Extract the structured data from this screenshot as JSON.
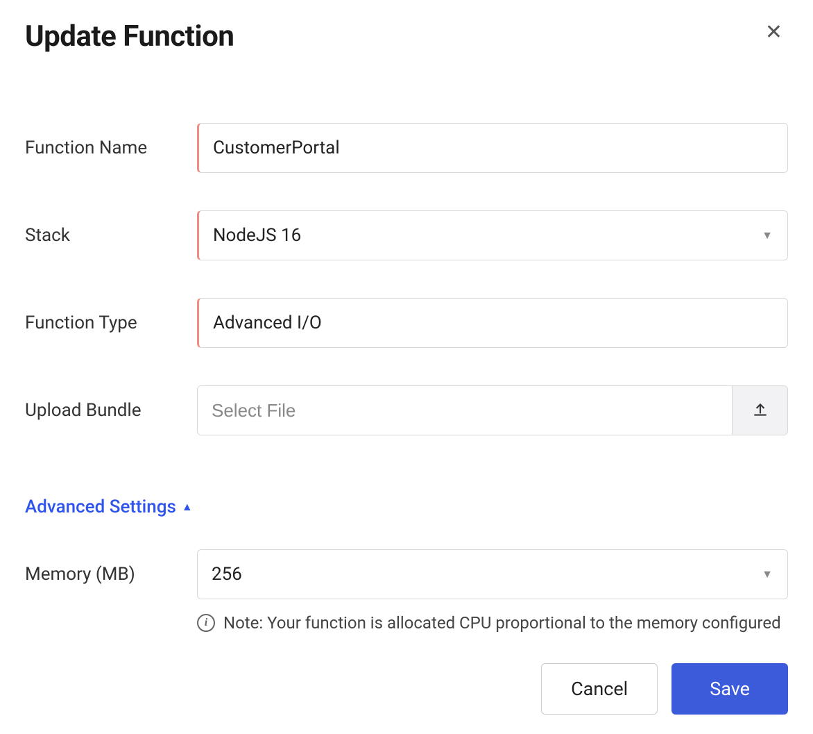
{
  "dialog": {
    "title": "Update Function",
    "fields": {
      "function_name": {
        "label": "Function Name",
        "value": "CustomerPortal"
      },
      "stack": {
        "label": "Stack",
        "value": "NodeJS 16"
      },
      "function_type": {
        "label": "Function Type",
        "value": "Advanced I/O"
      },
      "upload_bundle": {
        "label": "Upload Bundle",
        "placeholder": "Select File"
      },
      "memory": {
        "label": "Memory (MB)",
        "value": "256",
        "note": "Note: Your function is allocated CPU proportional to the memory configured"
      }
    },
    "advanced_toggle_label": "Advanced Settings",
    "buttons": {
      "cancel": "Cancel",
      "save": "Save"
    }
  }
}
